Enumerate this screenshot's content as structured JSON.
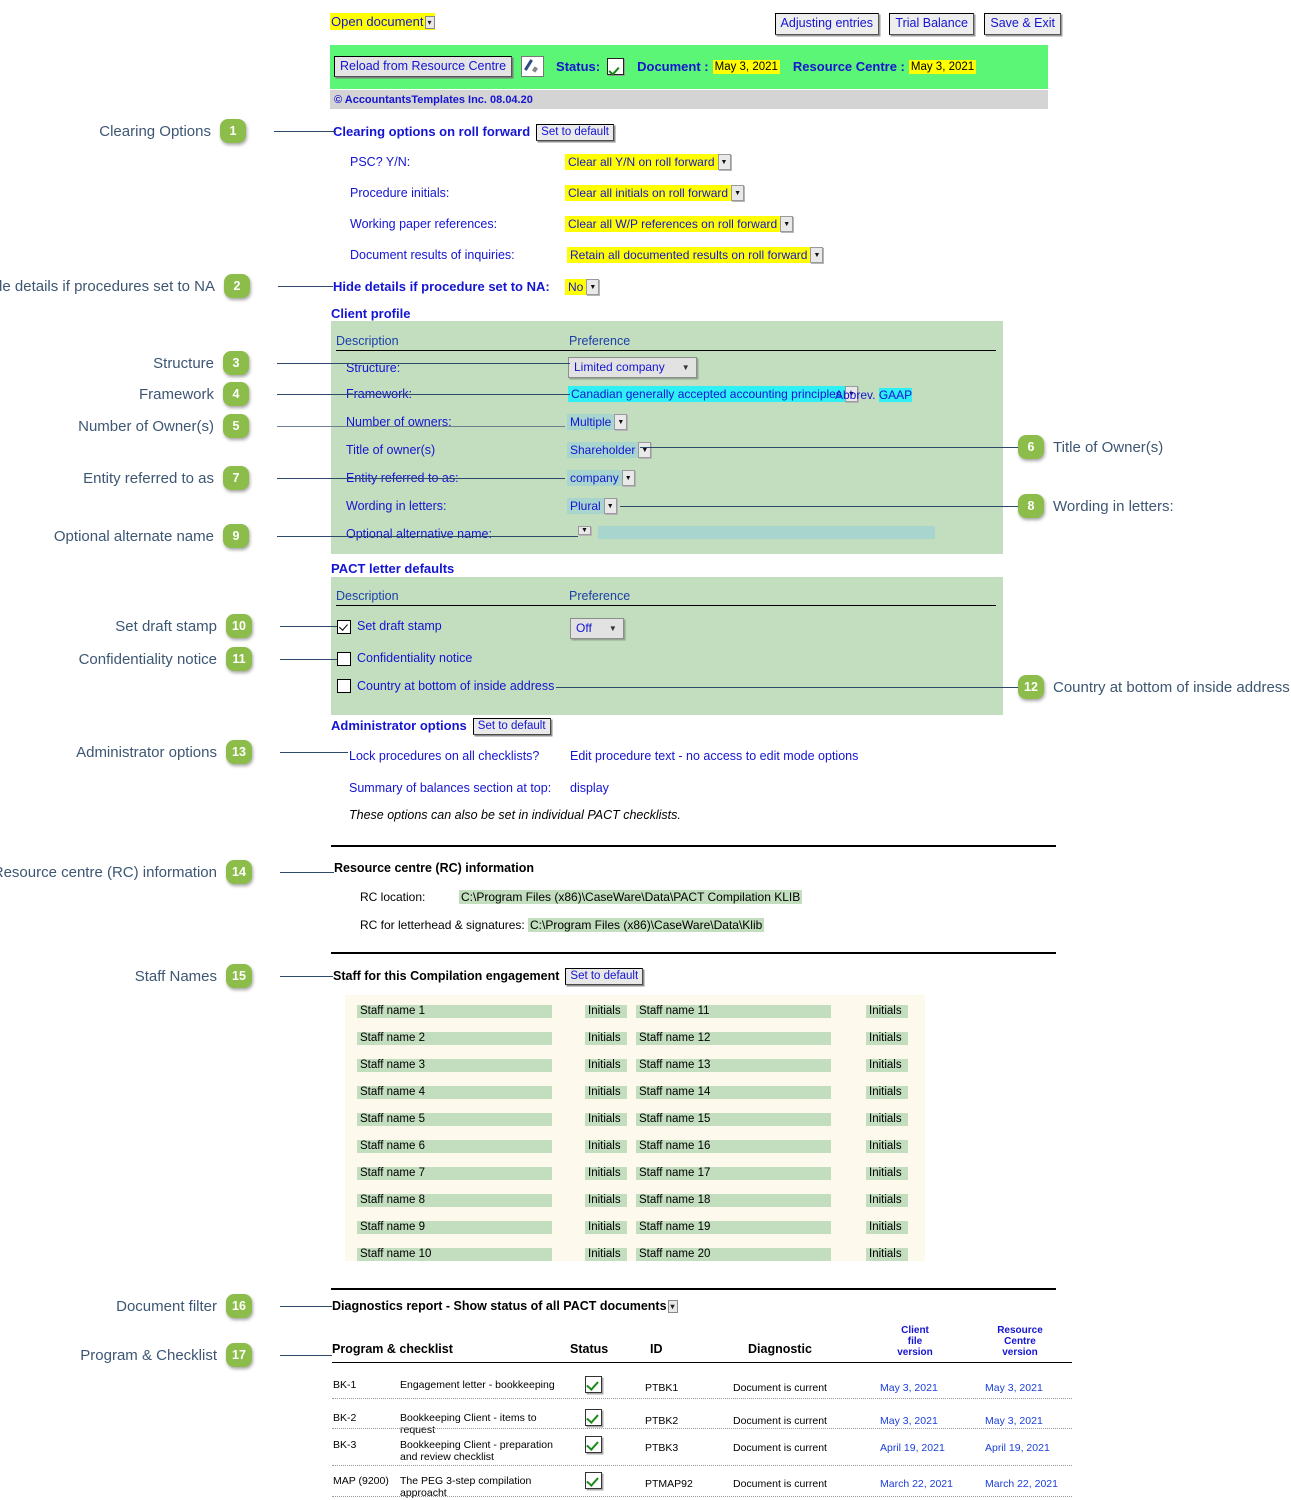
{
  "toolbar": {
    "open_document": "Open document",
    "adjusting_entries": "Adjusting entries",
    "trial_balance": "Trial Balance",
    "save_exit": "Save & Exit"
  },
  "status_bar": {
    "reload_button": "Reload from Resource Centre",
    "status_label": "Status:",
    "document_label": "Document :",
    "document_date": "May 3, 2021",
    "resource_centre_label": "Resource Centre :",
    "resource_centre_date": "May 3, 2021"
  },
  "copyright": "© AccountantsTemplates Inc. 08.04.20",
  "clearing": {
    "title": "Clearing options on roll forward",
    "set_default": "Set to default",
    "rows": [
      {
        "label": "PSC? Y/N:",
        "value": "Clear all Y/N on roll forward"
      },
      {
        "label": "Procedure initials:",
        "value": "Clear all initials on roll forward"
      },
      {
        "label": "Working paper references:",
        "value": "Clear all W/P references on roll forward"
      },
      {
        "label": "Document results of inquiries:",
        "value": "Retain all documented results on roll forward"
      }
    ],
    "hide_details_label": "Hide details if procedure set to NA:",
    "hide_details_value": "No"
  },
  "client_profile": {
    "title": "Client profile",
    "col_description": "Description",
    "col_preference": "Preference",
    "rows": [
      {
        "label": "Structure:",
        "value": "Limited company"
      },
      {
        "label": "Framework:",
        "value": "Canadian generally accepted accounting principles"
      },
      {
        "label": "Number of owners:",
        "value": "Multiple"
      },
      {
        "label": "Title of owner(s)",
        "value": "Shareholder"
      },
      {
        "label": "Entity referred to as:",
        "value": "company"
      },
      {
        "label": "Wording in letters:",
        "value": "Plural"
      },
      {
        "label": "Optional alternative name:",
        "value": ""
      }
    ],
    "abbrev_label": "Abbrev.",
    "abbrev_value": "GAAP"
  },
  "pact_letter": {
    "title": "PACT letter defaults",
    "col_description": "Description",
    "col_preference": "Preference",
    "rows": [
      {
        "label": "Set draft stamp",
        "checked": true,
        "value": "Off"
      },
      {
        "label": "Confidentiality notice",
        "checked": false,
        "value": ""
      },
      {
        "label": "Country at bottom of inside address",
        "checked": false,
        "value": ""
      }
    ]
  },
  "administrator": {
    "title": "Administrator options",
    "set_default": "Set to default",
    "lock_label": "Lock procedures on all checklists?",
    "lock_value": "Edit procedure text - no access to edit mode options",
    "summary_label": "Summary of balances section at top:",
    "summary_value": "display",
    "note": "These options can also be set in individual PACT checklists."
  },
  "resource_centre": {
    "title": "Resource centre (RC) information",
    "location_label": "RC location:",
    "location_value": "C:\\Program Files (x86)\\CaseWare\\Data\\PACT Compilation KLIB",
    "letterhead_label": "RC for letterhead & signatures:",
    "letterhead_value": "C:\\Program Files (x86)\\CaseWare\\Data\\Klib"
  },
  "staff": {
    "title": "Staff for this Compilation engagement",
    "set_default": "Set to default",
    "initials_label": "Initials",
    "left_column": [
      "Staff name 1",
      "Staff name 2",
      "Staff name 3",
      "Staff name 4",
      "Staff name 5",
      "Staff name 6",
      "Staff name 7",
      "Staff name 8",
      "Staff name 9",
      "Staff name 10"
    ],
    "right_column": [
      "Staff name 11",
      "Staff name 12",
      "Staff name 13",
      "Staff name 14",
      "Staff name 15",
      "Staff name 16",
      "Staff name 17",
      "Staff name 18",
      "Staff name 19",
      "Staff name 20"
    ]
  },
  "diagnostics": {
    "title": "Diagnostics report - Show status of all PACT documents",
    "columns": {
      "program": "Program & checklist",
      "status": "Status",
      "id": "ID",
      "diagnostic": "Diagnostic",
      "client_version": "Client\nfile\nversion",
      "client_version_l1": "Client",
      "client_version_l2": "file",
      "client_version_l3": "version",
      "rc_version_l1": "Resource",
      "rc_version_l2": "Centre",
      "rc_version_l3": "version"
    },
    "rows": [
      {
        "code": "BK-1",
        "name": "Engagement letter - bookkeeping",
        "id": "PTBK1",
        "diagnostic": "Document is current",
        "client_version": "May 3, 2021",
        "rc_version": "May 3, 2021"
      },
      {
        "code": "BK-2",
        "name": "Bookkeeping Client - items to request",
        "id": "PTBK2",
        "diagnostic": "Document is current",
        "client_version": "May 3, 2021",
        "rc_version": "May 3, 2021"
      },
      {
        "code": "BK-3",
        "name": "Bookkeeping Client - preparation and review checklist",
        "id": "PTBK3",
        "diagnostic": "Document is current",
        "client_version": "April 19, 2021",
        "rc_version": "April 19, 2021"
      },
      {
        "code": "MAP (9200)",
        "name": "The PEG 3-step compilation approacht",
        "id": "PTMAP92",
        "diagnostic": "Document is current",
        "client_version": "March 22, 2021",
        "rc_version": "March 22, 2021"
      }
    ]
  },
  "annotations": {
    "left": [
      {
        "num": "1",
        "label": "Clearing Options"
      },
      {
        "num": "2",
        "label": "Hide details if procedures set to NA"
      },
      {
        "num": "3",
        "label": "Structure"
      },
      {
        "num": "4",
        "label": "Framework"
      },
      {
        "num": "5",
        "label": "Number of Owner(s)"
      },
      {
        "num": "7",
        "label": "Entity referred to as"
      },
      {
        "num": "9",
        "label": "Optional alternate name"
      },
      {
        "num": "10",
        "label": "Set draft stamp"
      },
      {
        "num": "11",
        "label": "Confidentiality notice"
      },
      {
        "num": "13",
        "label": "Administrator options"
      },
      {
        "num": "14",
        "label": "Resource centre (RC) information"
      },
      {
        "num": "15",
        "label": "Staff Names"
      },
      {
        "num": "16",
        "label": "Document filter"
      },
      {
        "num": "17",
        "label": "Program & Checklist"
      }
    ],
    "right": [
      {
        "num": "6",
        "label": "Title of Owner(s)"
      },
      {
        "num": "8",
        "label": "Wording in letters:"
      },
      {
        "num": "12",
        "label": "Country at bottom of inside address"
      }
    ]
  },
  "colors": {
    "badge_green": "#8cbd4a",
    "panel_green": "#c3debe",
    "header_green": "#5bf675",
    "highlight_yellow": "#ffff00",
    "highlight_cyan": "#2ef0f5",
    "link_blue": "#1414d2",
    "annotation_blue": "#3d5673",
    "staff_cream": "#fdf9ed"
  }
}
